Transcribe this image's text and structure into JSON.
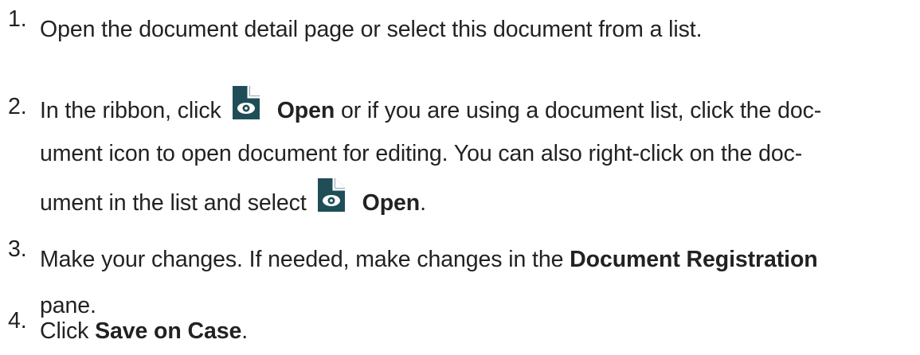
{
  "steps": [
    {
      "number": "1.",
      "text": "Open the document detail page or select this document from a list."
    },
    {
      "number": "2.",
      "line1_before": "In the ribbon, click",
      "line1_icon": "document-open-icon",
      "line1_bold": "Open",
      "line1_after": " or if you are using a document list, click the doc-",
      "line2": "ument icon to open document for editing. You can also right-click on the doc-",
      "line3_before": "ument in the list and select",
      "line3_icon": "document-open-icon",
      "line3_bold": "Open",
      "line3_after": "."
    },
    {
      "number": "3.",
      "line1_before": "Make your changes. If needed, make changes in the ",
      "line1_bold": "Document Registration",
      "line2": "pane."
    },
    {
      "number": "4.",
      "before": "Click ",
      "bold": "Save on Case",
      "after": "."
    }
  ],
  "colors": {
    "text": "#222222",
    "icon_fill": "#1f4e57",
    "icon_eye": "#ffffff"
  }
}
